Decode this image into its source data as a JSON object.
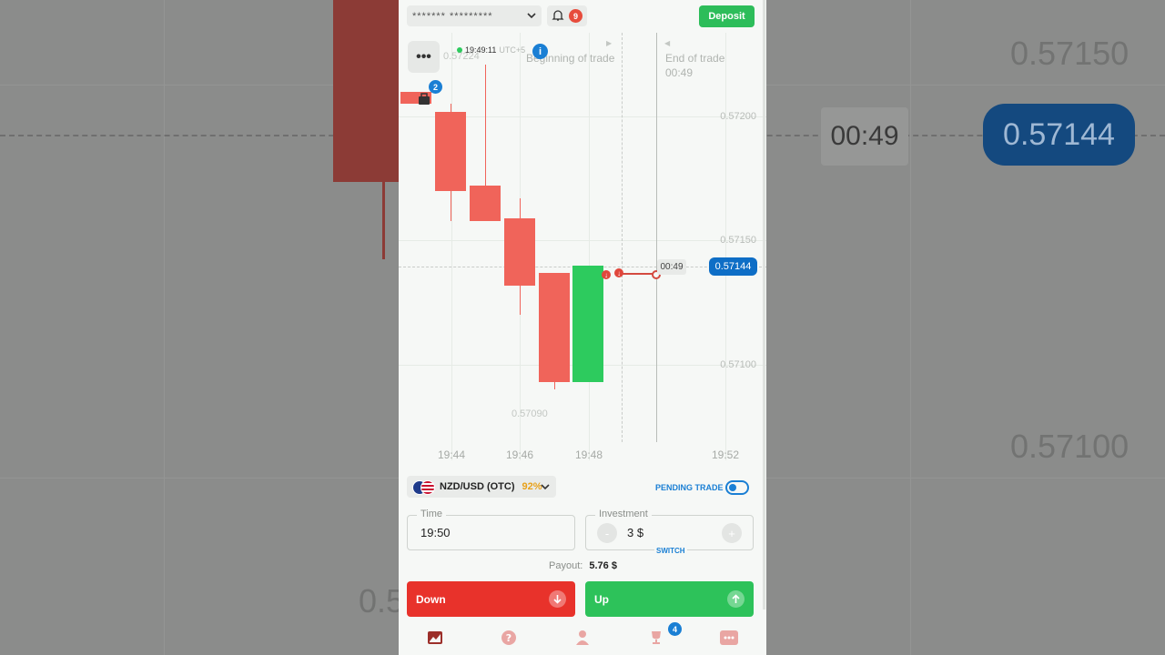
{
  "topbar": {
    "account_masked": "******* *********",
    "notifications_count": "9",
    "deposit_label": "Deposit"
  },
  "chart": {
    "clock_time": "19:49:11",
    "clock_tz": "UTC+5",
    "high_label": "0.57224",
    "low_label": "0.57090",
    "beginning_label": "Beginning of trade",
    "end_label": "End of trade",
    "end_countdown": "00:49",
    "timer": "00:49",
    "current_price": "0.57144",
    "price_ticks": [
      "0.57200",
      "0.57150",
      "0.57100"
    ],
    "time_ticks": [
      "19:44",
      "19:46",
      "19:48",
      "19:52"
    ],
    "portfolio_count": "2",
    "colors": {
      "bearish": "#f0645a",
      "bullish": "#2dcb5e",
      "accent": "#0e6ec6"
    }
  },
  "chart_data": {
    "type": "candlestick",
    "ylim": [
      0.5708,
      0.5723
    ],
    "candles": [
      {
        "open": 0.5721,
        "high": 0.5721,
        "low": 0.5721,
        "close": 0.57205,
        "dir": "down"
      },
      {
        "open": 0.57202,
        "high": 0.57205,
        "low": 0.57158,
        "close": 0.5717,
        "dir": "down"
      },
      {
        "open": 0.57172,
        "high": 0.57221,
        "low": 0.57158,
        "close": 0.57158,
        "dir": "down"
      },
      {
        "open": 0.57159,
        "high": 0.57167,
        "low": 0.5712,
        "close": 0.57132,
        "dir": "down"
      },
      {
        "open": 0.57137,
        "high": 0.57137,
        "low": 0.5709,
        "close": 0.57093,
        "dir": "down"
      },
      {
        "open": 0.57093,
        "high": 0.5714,
        "low": 0.57093,
        "close": 0.5714,
        "dir": "up"
      }
    ]
  },
  "trade": {
    "pair": "NZD/USD (OTC)",
    "payout_pct": "92%",
    "pending_label": "PENDING TRADE",
    "time_legend": "Time",
    "time_value": "19:50",
    "investment_legend": "Investment",
    "investment_value": "3 $",
    "minus": "-",
    "plus": "+",
    "switch_label": "SWITCH",
    "payout_label": "Payout:",
    "payout_value": "5.76 $",
    "down_label": "Down",
    "up_label": "Up"
  },
  "nav": {
    "trophy_count": "4"
  },
  "background": {
    "prices": [
      "0.57150",
      "0.57100",
      "0.5"
    ],
    "timer": "00:49",
    "price": "0.57144"
  }
}
